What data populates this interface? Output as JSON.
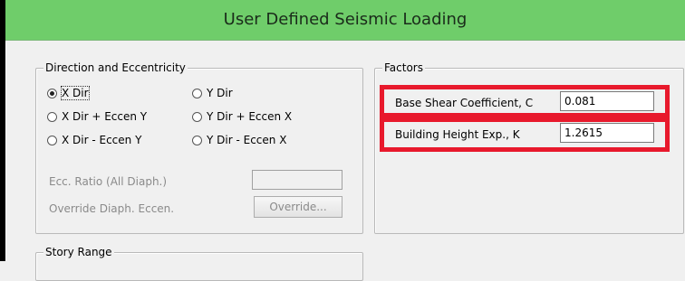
{
  "window": {
    "title": "User Defined Seismic Loading"
  },
  "direction_group": {
    "legend": "Direction and Eccentricity",
    "options": [
      {
        "label": "X Dir",
        "checked": true
      },
      {
        "label": "Y Dir",
        "checked": false
      },
      {
        "label": "X Dir + Eccen Y",
        "checked": false
      },
      {
        "label": "Y Dir + Eccen X",
        "checked": false
      },
      {
        "label": "X Dir - Eccen Y",
        "checked": false
      },
      {
        "label": "Y Dir - Eccen X",
        "checked": false
      }
    ],
    "ecc_ratio_label": "Ecc. Ratio (All Diaph.)",
    "ecc_ratio_value": "",
    "override_label": "Override Diaph. Eccen.",
    "override_button": "Override..."
  },
  "factors_group": {
    "legend": "Factors",
    "base_shear_label": "Base Shear Coefficient, C",
    "base_shear_value": "0.081",
    "height_exp_label": "Building Height Exp., K",
    "height_exp_value": "1.2615"
  },
  "story_range_group": {
    "legend": "Story Range"
  },
  "annotation": {
    "highlight_color": "#e8192c"
  }
}
